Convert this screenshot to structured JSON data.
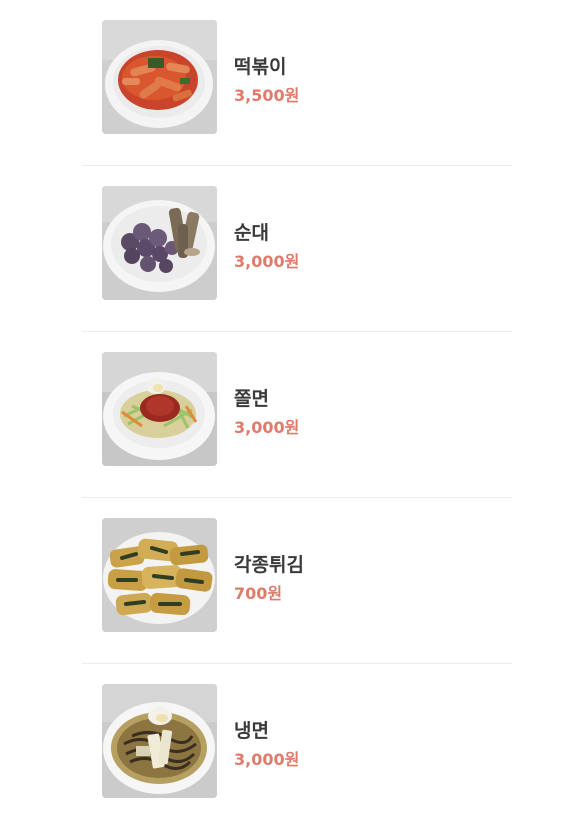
{
  "menu": {
    "items": [
      {
        "name": "떡볶이",
        "price": "3,500원",
        "photo_icon": "tteokbokki-photo"
      },
      {
        "name": "순대",
        "price": "3,000원",
        "photo_icon": "sundae-photo"
      },
      {
        "name": "쫄면",
        "price": "3,000원",
        "photo_icon": "jjolmyeon-photo"
      },
      {
        "name": "각종튀김",
        "price": "700원",
        "photo_icon": "twigim-photo"
      },
      {
        "name": "냉면",
        "price": "3,000원",
        "photo_icon": "naengmyeon-photo"
      }
    ]
  },
  "colors": {
    "price": "#e07a6a",
    "name": "#3a3a3a",
    "divider": "#ececec"
  }
}
